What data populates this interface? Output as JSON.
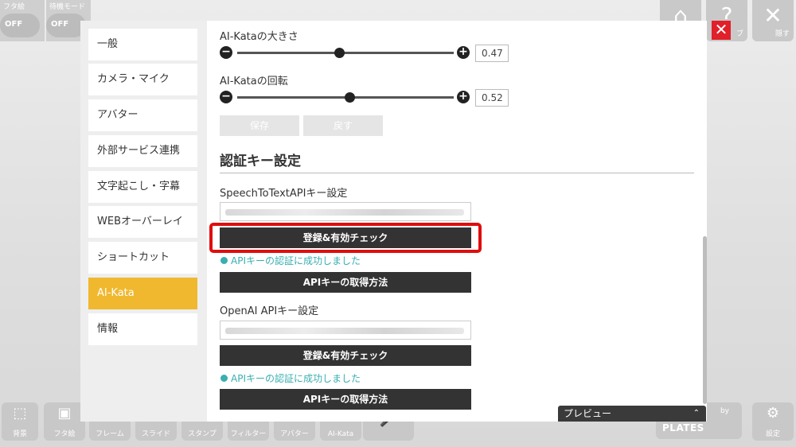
{
  "top_left": [
    {
      "label": "フタ絵",
      "value": "OFF"
    },
    {
      "label": "待機モード",
      "value": "OFF"
    }
  ],
  "top_right": [
    {
      "icon": "home-icon",
      "glyph": "⌂",
      "label": ""
    },
    {
      "icon": "help-icon",
      "glyph": "?",
      "label": "ブ"
    },
    {
      "icon": "hide-icon",
      "glyph": "✕",
      "label": "隠す"
    }
  ],
  "bottom_toolbar": [
    {
      "icon": "background-icon",
      "glyph": "⬚",
      "label": "背景"
    },
    {
      "icon": "cover-icon",
      "glyph": "▣",
      "label": "フタ絵"
    },
    {
      "icon": "frame-icon",
      "glyph": "▭",
      "label": "フレーム"
    },
    {
      "icon": "slide-icon",
      "glyph": "▯",
      "label": "スライド"
    },
    {
      "icon": "stamp-icon",
      "glyph": "◌",
      "label": "スタンプ"
    },
    {
      "icon": "filter-icon",
      "glyph": "◍",
      "label": "フィルター"
    },
    {
      "icon": "avatar-icon",
      "glyph": "☺",
      "label": "アバター"
    },
    {
      "icon": "ai-kata-icon",
      "glyph": "♟",
      "label": "AI-Kata"
    },
    {
      "icon": "mic-icon",
      "glyph": "🎤",
      "label": ""
    }
  ],
  "brand": {
    "by": "by",
    "name": "KID'S PLATES"
  },
  "settings": {
    "label": "設定"
  },
  "sidebar": {
    "items": [
      {
        "label": "一般"
      },
      {
        "label": "カメラ・マイク"
      },
      {
        "label": "アバター"
      },
      {
        "label": "外部サービス連携"
      },
      {
        "label": "文字起こし・字幕"
      },
      {
        "label": "WEBオーバーレイ"
      },
      {
        "label": "ショートカット"
      },
      {
        "label": "AI-Kata"
      },
      {
        "label": "情報"
      }
    ],
    "active_index": 7
  },
  "ai_kata": {
    "size_label": "AI-Kataの大きさ",
    "size_value": "0.47",
    "size_fraction": 0.47,
    "rotation_label": "AI-Kataの回転",
    "rotation_value": "0.52",
    "rotation_fraction": 0.52,
    "save_label": "保存",
    "revert_label": "戻す"
  },
  "auth": {
    "section_title": "認証キー設定",
    "speech": {
      "title": "SpeechToTextAPIキー設定",
      "register_label": "登録&有効チェック",
      "success_text": "APIキーの認証に成功しました",
      "howto_label": "APIキーの取得方法"
    },
    "openai": {
      "title": "OpenAI APIキー設定",
      "register_label": "登録&有効チェック",
      "success_text": "APIキーの認証に成功しました",
      "howto_label": "APIキーの取得方法"
    }
  },
  "preview": {
    "label": "プレビュー"
  },
  "colors": {
    "accent": "#f0b82f",
    "success": "#3aaeb0",
    "highlight": "#e00d0d",
    "close": "#e0202a"
  }
}
